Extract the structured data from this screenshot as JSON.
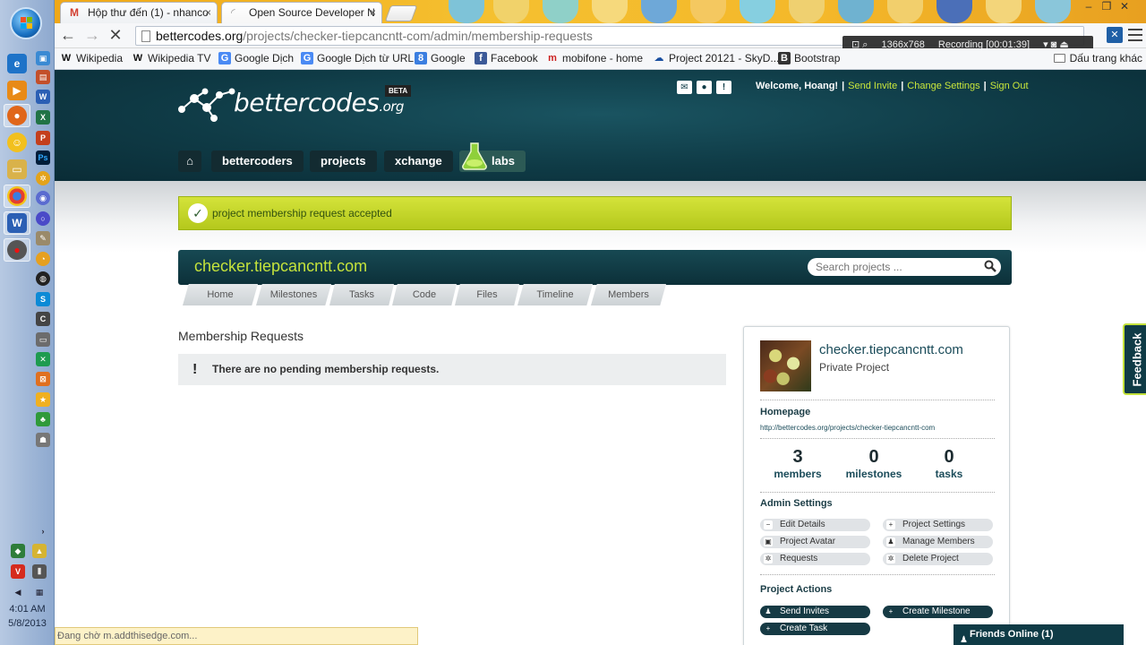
{
  "taskbar": {
    "clock_time": "4:01 AM",
    "clock_date": "5/8/2013"
  },
  "browser": {
    "tabs": [
      {
        "label": "Hộp thư đến (1) - nhanco",
        "close": "×"
      },
      {
        "label": "Open Source Developer N",
        "close": "×"
      }
    ],
    "url_domain": "bettercodes.org",
    "url_path": "/projects/checker-tiepcancntt-com/admin/membership-requests",
    "recorder": {
      "resolution": "1366x768",
      "status": "Recording [00:01:39]"
    },
    "bookmarks": [
      {
        "label": "Wikipedia",
        "icon": "W"
      },
      {
        "label": "Wikipedia TV",
        "icon": "W"
      },
      {
        "label": "Google Dịch",
        "icon": "G"
      },
      {
        "label": "Google Dịch từ URL",
        "icon": "G"
      },
      {
        "label": "Google",
        "icon": "8"
      },
      {
        "label": "Facebook",
        "icon": "f"
      },
      {
        "label": "mobifone - home",
        "icon": "m"
      },
      {
        "label": "Project 20121 - SkyD...",
        "icon": "☁"
      },
      {
        "label": "Bootstrap",
        "icon": "B"
      }
    ],
    "other_bookmarks": "Dấu trang khác",
    "status_text": "Đang chờ m.addthisedge.com..."
  },
  "site": {
    "logo_main": "bettercodes",
    "logo_tld": ".org",
    "beta": "BETA",
    "welcome": "Welcome, Hoang!",
    "links": [
      "Send Invite",
      "Change Settings",
      "Sign Out"
    ],
    "nav": [
      "bettercoders",
      "projects",
      "xchange",
      "labs"
    ]
  },
  "flash": "project membership request accepted",
  "project": {
    "title": "checker.tiepcancntt.com",
    "search_placeholder": "Search projects ...",
    "tabs": [
      "Home",
      "Milestones",
      "Tasks",
      "Code",
      "Files",
      "Timeline",
      "Members"
    ]
  },
  "membership": {
    "heading": "Membership Requests",
    "empty_message": "There are no pending membership requests."
  },
  "sidebar": {
    "name": "checker.tiepcancntt.com",
    "visibility": "Private Project",
    "homepage_label": "Homepage",
    "homepage_url": "http://bettercodes.org/projects/checker-tiepcancntt-com",
    "stats": [
      {
        "value": "3",
        "label": "members"
      },
      {
        "value": "0",
        "label": "milestones"
      },
      {
        "value": "0",
        "label": "tasks"
      }
    ],
    "admin_label": "Admin Settings",
    "admin_items": [
      "Edit Details",
      "Project Settings",
      "Project Avatar",
      "Manage Members",
      "Requests",
      "Delete Project"
    ],
    "actions_label": "Project Actions",
    "action_items": [
      "Send Invites",
      "Create Milestone",
      "Create Task"
    ]
  },
  "feedback": "Feedback",
  "friends": "Friends Online (1)"
}
